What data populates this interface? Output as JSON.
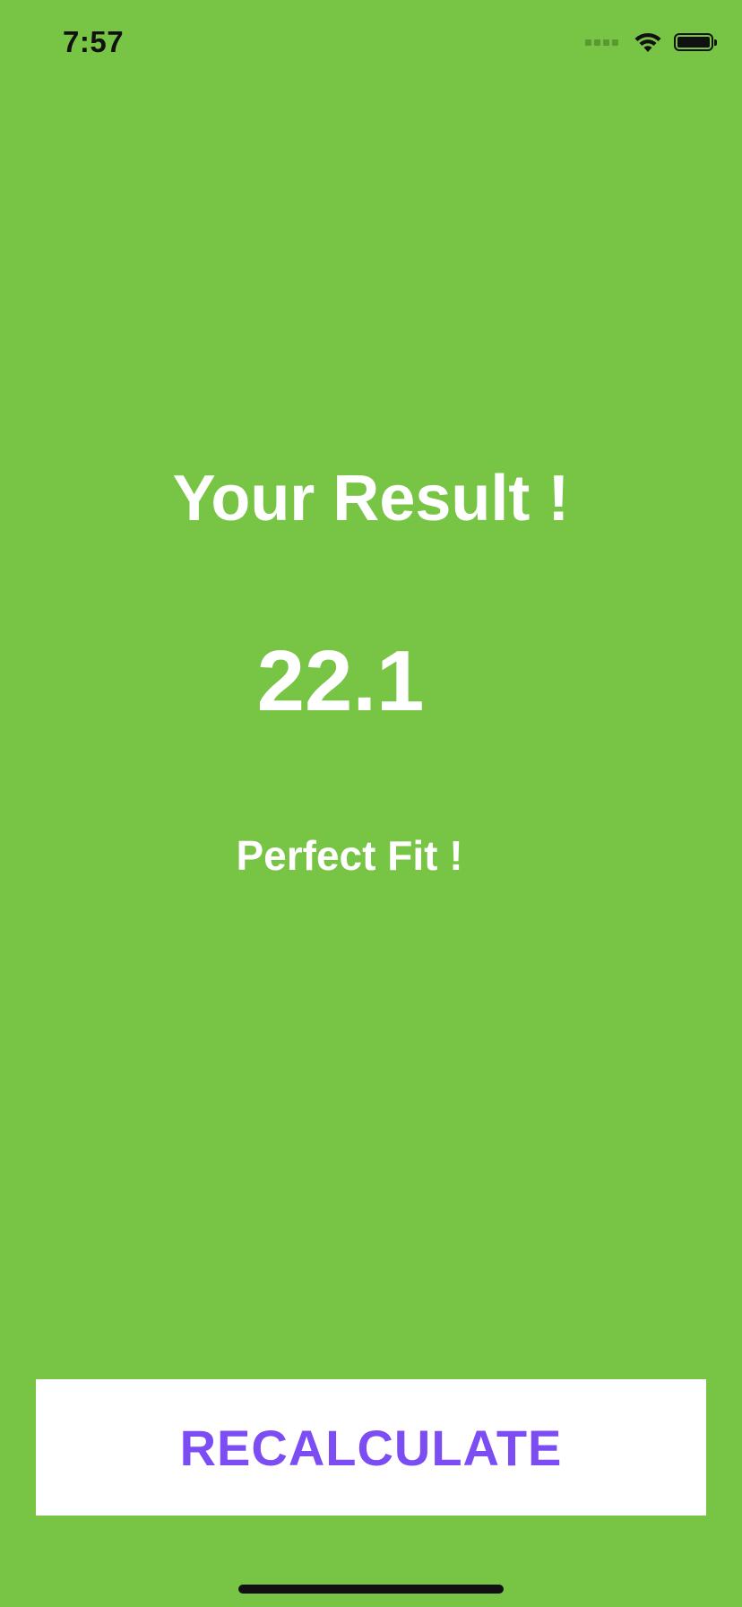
{
  "status_bar": {
    "time": "7:57",
    "icons": [
      "cellular-signal-icon",
      "wifi-icon",
      "battery-icon"
    ]
  },
  "result": {
    "title": "Your Result !",
    "value": "22.1",
    "advice": "Perfect Fit !"
  },
  "actions": {
    "recalculate_label": "RECALCULATE"
  },
  "colors": {
    "background": "#78C546",
    "text": "#FFFFFF",
    "button_background": "#FFFFFF",
    "button_text": "#7B4DF2"
  }
}
